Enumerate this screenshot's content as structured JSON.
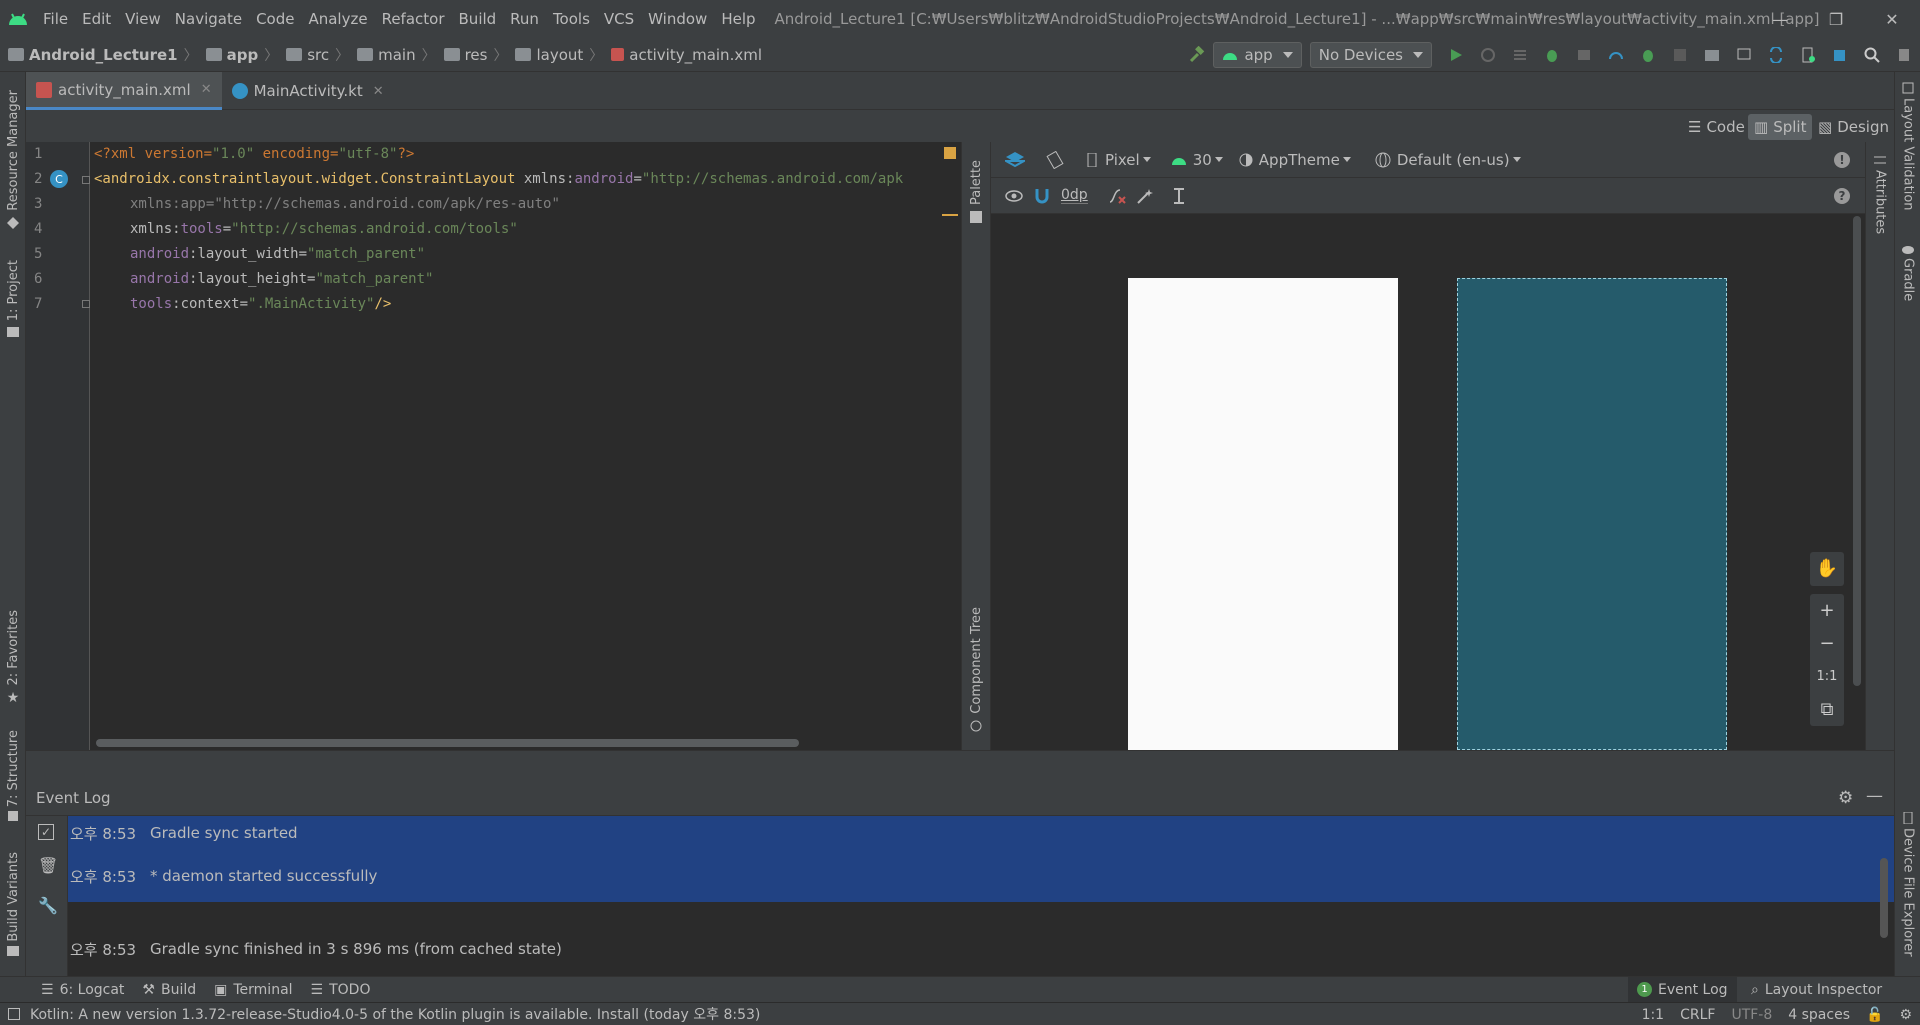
{
  "menubar": {
    "items": [
      "File",
      "Edit",
      "View",
      "Navigate",
      "Code",
      "Analyze",
      "Refactor",
      "Build",
      "Run",
      "Tools",
      "VCS",
      "Window",
      "Help"
    ],
    "window_title": "Android_Lecture1 [C:₩Users₩blitz₩AndroidStudioProjects₩Android_Lecture1] - ...₩app₩src₩main₩res₩layout₩activity_main.xml [app]"
  },
  "breadcrumb": {
    "project": "Android_Lecture1",
    "module": "app",
    "src": "src",
    "main": "main",
    "res": "res",
    "layout": "layout",
    "file": "activity_main.xml"
  },
  "toolbar": {
    "run_config": "app",
    "device": "No Devices"
  },
  "editor_tabs": [
    {
      "label": "activity_main.xml",
      "active": true
    },
    {
      "label": "MainActivity.kt",
      "active": false
    }
  ],
  "view_modes": {
    "code": "Code",
    "split": "Split",
    "design": "Design"
  },
  "code": {
    "line_numbers": [
      "1",
      "2",
      "3",
      "4",
      "5",
      "6",
      "7"
    ],
    "lines": {
      "l1_a": "<?xml version=",
      "l1_b": "\"1.0\"",
      "l1_c": " encoding=",
      "l1_d": "\"utf-8\"",
      "l1_e": "?>",
      "l2_tag": "<androidx.constraintlayout.widget.ConstraintLayout",
      "l2_attr": " xmlns:",
      "l2_ns": "android",
      "l2_eq": "=",
      "l2_val": "\"http://schemas.android.com/apk",
      "l3_attr": "xmlns:",
      "l3_ns": "app",
      "l3_eq": "=",
      "l3_val": "\"http://schemas.android.com/apk/res-auto\"",
      "l4_attr": "xmlns:",
      "l4_ns": "tools",
      "l4_eq": "=",
      "l4_val": "\"http://schemas.android.com/tools\"",
      "l5_ns": "android",
      "l5_attr": ":layout_width=",
      "l5_val": "\"match_parent\"",
      "l6_ns": "android",
      "l6_attr": ":layout_height=",
      "l6_val": "\"match_parent\"",
      "l7_ns": "tools",
      "l7_attr": ":context=",
      "l7_val": "\".MainActivity\"",
      "l7_end": "/>"
    }
  },
  "design": {
    "palette_label": "Palette",
    "component_tree_label": "Component Tree",
    "device": "Pixel",
    "api": "30",
    "theme": "AppTheme",
    "locale": "Default (en-us)",
    "margin": "0dp",
    "zoom_1to1": "1:1",
    "attributes_label": "Attributes",
    "blueprint_color": "#255b6b"
  },
  "right_strip": {
    "layout_validation": "Layout Validation",
    "gradle": "Gradle",
    "device_file_explorer": "Device File Explorer"
  },
  "left_strip": {
    "resource_manager": "Resource Manager",
    "project": "1: Project",
    "favorites": "2: Favorites",
    "structure": "7: Structure",
    "build_variants": "Build Variants"
  },
  "event_log": {
    "title": "Event Log",
    "entries": [
      {
        "time": "오후 8:53",
        "message": "Gradle sync started"
      },
      {
        "time": "오후 8:53",
        "message": "* daemon started successfully"
      },
      {
        "time": "오후 8:53",
        "message": "Gradle sync finished in 3 s 896 ms (from cached state)"
      }
    ]
  },
  "bottom_tabs": {
    "logcat": "6: Logcat",
    "build": "Build",
    "terminal": "Terminal",
    "todo": "TODO",
    "event_log": "Event Log",
    "event_log_count": "1",
    "layout_inspector": "Layout Inspector"
  },
  "statusbar": {
    "message": "Kotlin: A new version 1.3.72-release-Studio4.0-5 of the Kotlin plugin is available. Install (today 오후 8:53)",
    "position": "1:1",
    "line_sep": "CRLF",
    "encoding": "UTF-8",
    "indent": "4 spaces"
  }
}
